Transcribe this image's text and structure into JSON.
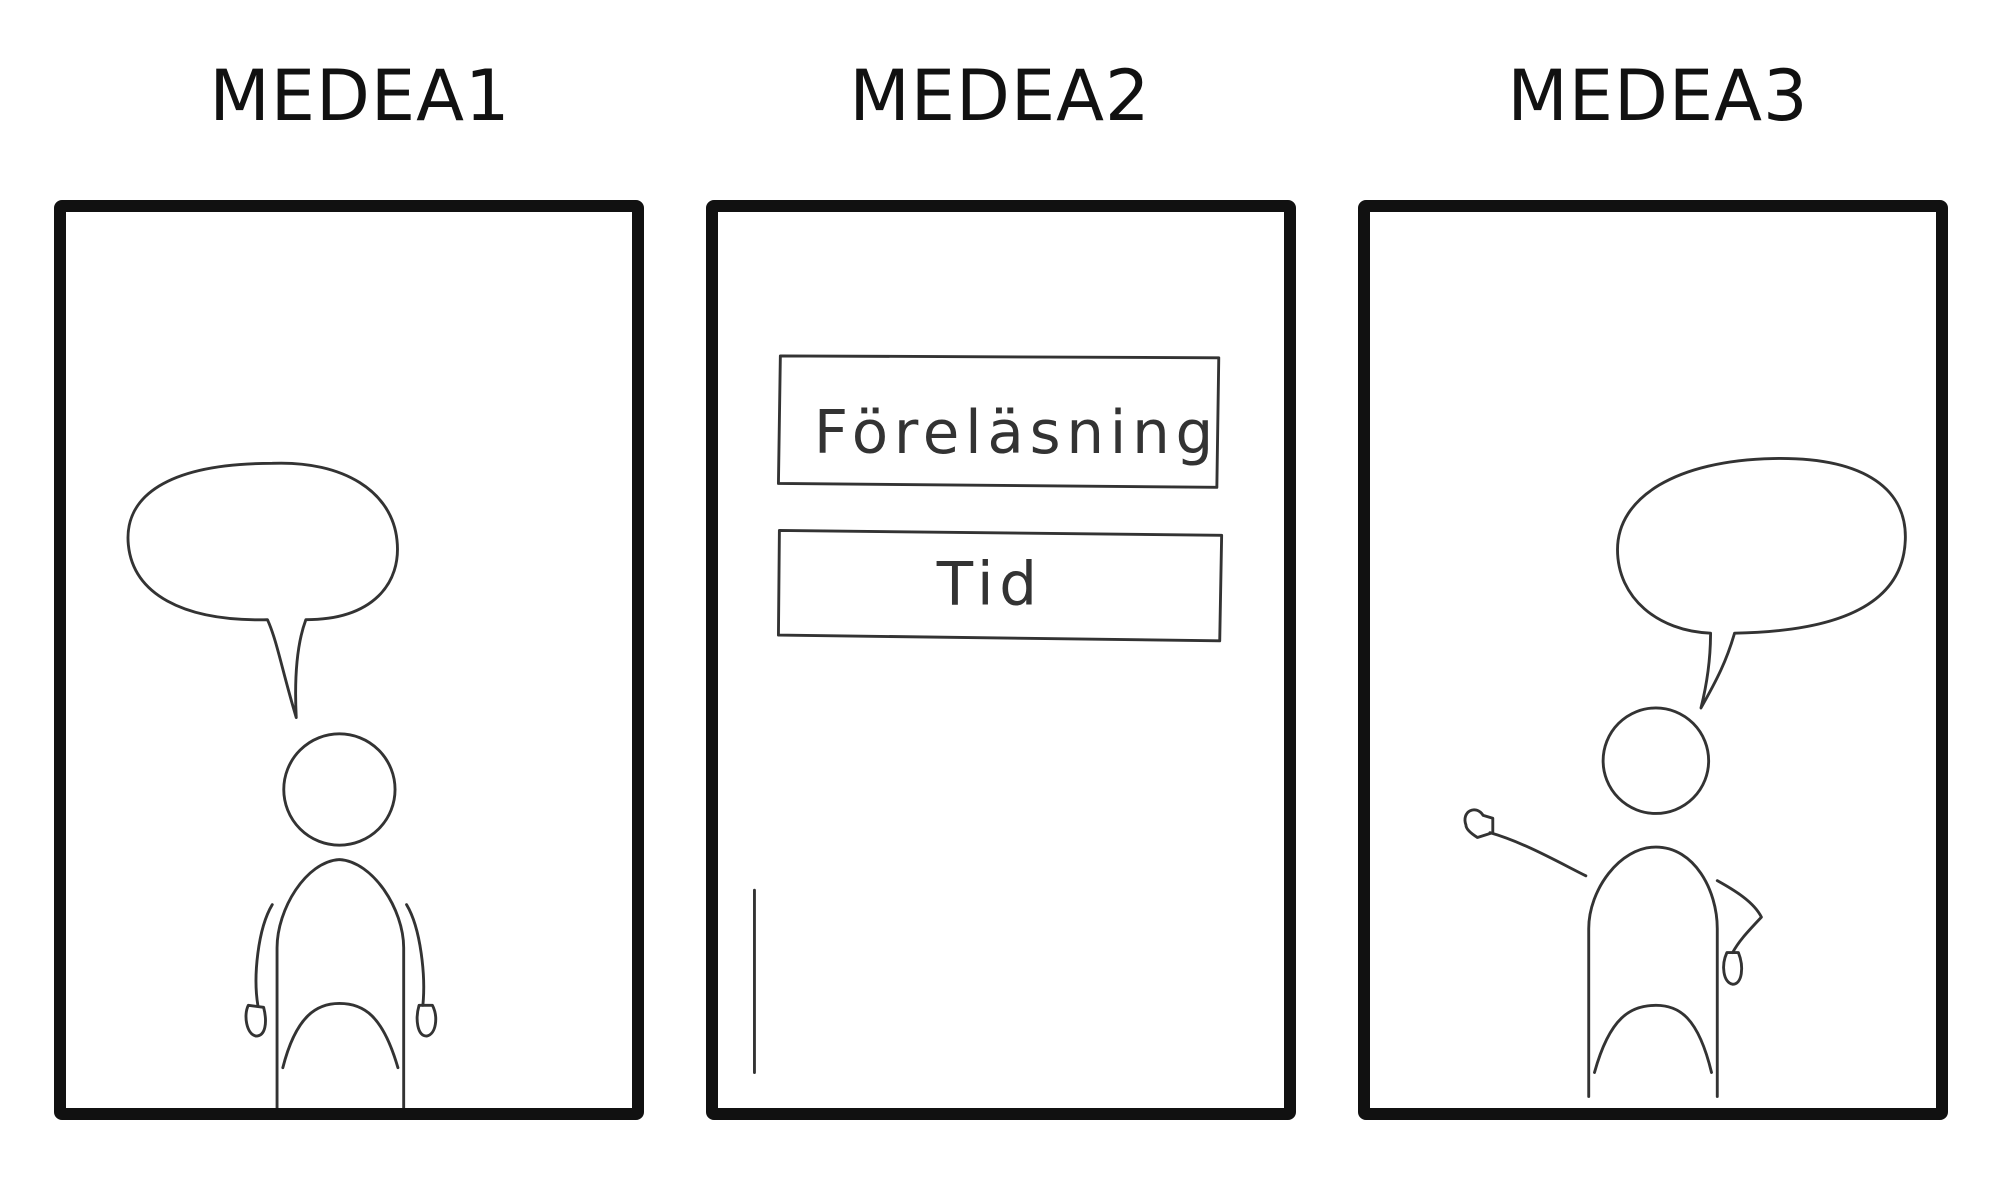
{
  "panels": [
    {
      "title": "MEDEA1"
    },
    {
      "title": "MEDEA2",
      "boxes": [
        "Föreläsning",
        "Tid"
      ]
    },
    {
      "title": "MEDEA3"
    }
  ]
}
